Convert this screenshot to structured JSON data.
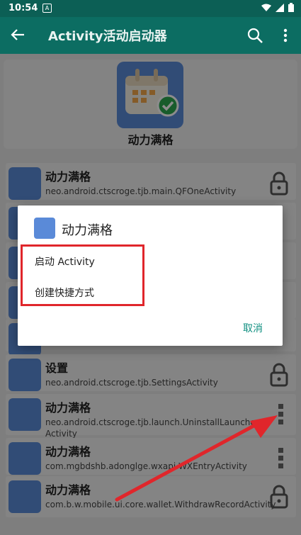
{
  "statusbar": {
    "time": "10:54",
    "notif": "A"
  },
  "appbar": {
    "title": "Activity活动启动器"
  },
  "header": {
    "app_name": "动力满格"
  },
  "rows": [
    {
      "name": "动力满格",
      "cls": "neo.android.ctscroge.tjb.main.QFOneActivity",
      "action": "lock"
    },
    {
      "name": "设置",
      "cls": "neo.android.ctscroge.tjb.SettingsActivity",
      "action": "lock"
    },
    {
      "name": "动力满格",
      "cls": "neo.android.ctscroge.tjb.launch.UninstallLauncher Activity",
      "action": "more"
    },
    {
      "name": "动力满格",
      "cls": "com.mgbdshb.adonglge.wxapi.WXEntryActivity",
      "action": "more"
    },
    {
      "name": "动力满格",
      "cls": "com.b.w.mobile.ui.core.wallet.WithdrawRecordActivity",
      "action": "lock"
    }
  ],
  "dialog": {
    "title": "动力满格",
    "options": [
      "启动 Activity",
      "创建快捷方式"
    ],
    "cancel": "取消"
  },
  "colors": {
    "appbar": "#0c6d62",
    "statusbar": "#0c5f55",
    "accent": "#0f8f80",
    "highlight": "#e0262b"
  }
}
